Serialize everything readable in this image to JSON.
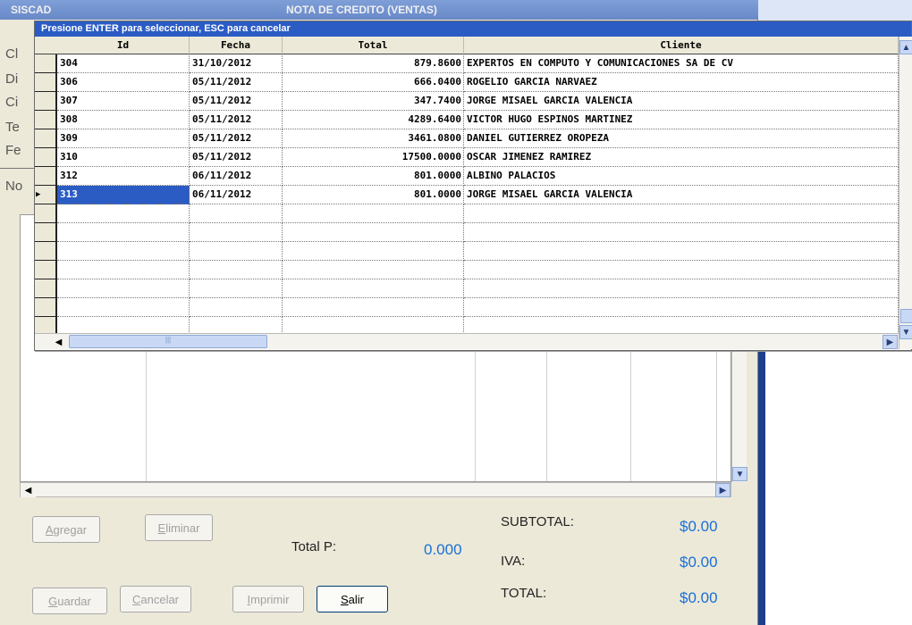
{
  "main": {
    "app_title": "SISCAD",
    "doc_title": "NOTA DE CREDITO (VENTAS)",
    "side_labels": [
      "Cl",
      "Di",
      "Ci",
      "Te",
      "Fe",
      "No"
    ]
  },
  "popup": {
    "title": "Presione ENTER para seleccionar, ESC para cancelar",
    "columns": [
      "Id",
      "Fecha",
      "Total",
      "Cliente"
    ],
    "rows": [
      {
        "id": "304",
        "fecha": "31/10/2012",
        "total": "879.8600",
        "cliente": "EXPERTOS EN COMPUTO Y COMUNICACIONES SA DE CV"
      },
      {
        "id": "306",
        "fecha": "05/11/2012",
        "total": "666.0400",
        "cliente": "ROGELIO GARCIA NARVAEZ"
      },
      {
        "id": "307",
        "fecha": "05/11/2012",
        "total": "347.7400",
        "cliente": "JORGE MISAEL GARCIA VALENCIA"
      },
      {
        "id": "308",
        "fecha": "05/11/2012",
        "total": "4289.6400",
        "cliente": "VICTOR HUGO ESPINOS MARTINEZ"
      },
      {
        "id": "309",
        "fecha": "05/11/2012",
        "total": "3461.0800",
        "cliente": "DANIEL GUTIERREZ OROPEZA"
      },
      {
        "id": "310",
        "fecha": "05/11/2012",
        "total": "17500.0000",
        "cliente": "OSCAR JIMENEZ RAMIREZ"
      },
      {
        "id": "312",
        "fecha": "06/11/2012",
        "total": "801.0000",
        "cliente": "ALBINO PALACIOS"
      },
      {
        "id": "313",
        "fecha": "06/11/2012",
        "total": "801.0000",
        "cliente": "JORGE MISAEL GARCIA VALENCIA"
      }
    ],
    "selected_index": 7,
    "empty_rows": 7
  },
  "buttons": {
    "agregar": {
      "first": "A",
      "rest": "gregar"
    },
    "eliminar": {
      "first": "E",
      "rest": "liminar"
    },
    "guardar": {
      "first": "G",
      "rest": "uardar"
    },
    "cancelar": {
      "first": "C",
      "rest": "ancelar"
    },
    "imprimir": {
      "first": "I",
      "rest": "mprimir"
    },
    "salir": {
      "first": "S",
      "rest": "alir"
    }
  },
  "totals": {
    "total_p_label": "Total P:",
    "total_p_value": "0.000",
    "subtotal_label": "SUBTOTAL:",
    "subtotal_value": "$0.00",
    "iva_label": "IVA:",
    "iva_value": "$0.00",
    "total_label": "TOTAL:",
    "total_value": "$0.00"
  },
  "colors": {
    "accent": "#2b5cc4",
    "value_blue": "#1a6fd6",
    "window_bg": "#ece9d8"
  }
}
